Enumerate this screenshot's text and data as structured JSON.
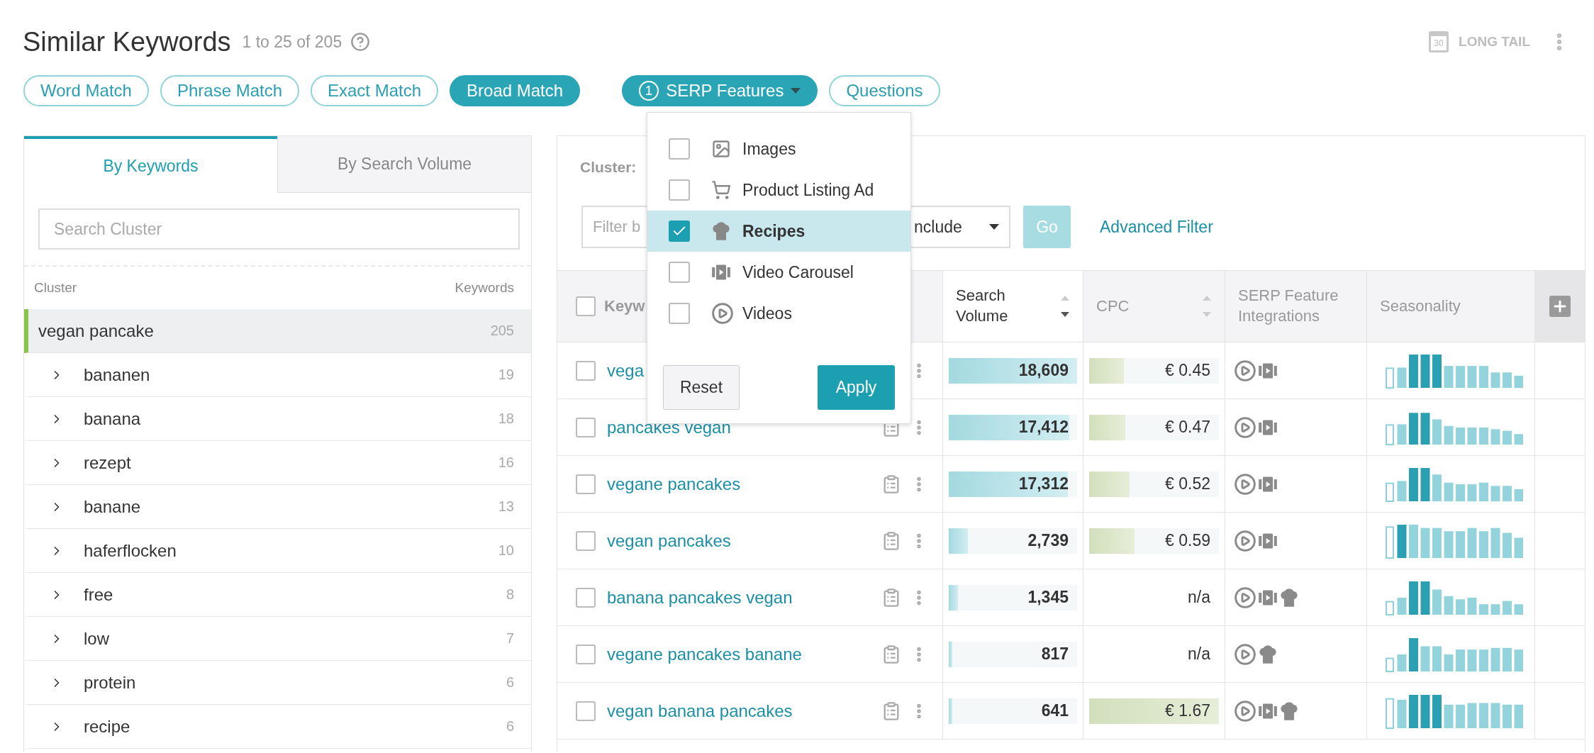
{
  "header": {
    "title": "Similar Keywords",
    "count": "1 to 25 of 205"
  },
  "tools": {
    "calendar_day": "30",
    "label": "LONG TAIL"
  },
  "match_filters": [
    {
      "label": "Word Match",
      "selected": false
    },
    {
      "label": "Phrase Match",
      "selected": false
    },
    {
      "label": "Exact Match",
      "selected": false
    },
    {
      "label": "Broad Match",
      "selected": true
    }
  ],
  "serp_button": {
    "badge": "1",
    "label": "SERP Features",
    "expanded": true
  },
  "questions_button": {
    "label": "Questions"
  },
  "serp_menu": {
    "items": [
      {
        "kind": "images",
        "label": "Images",
        "checked": false
      },
      {
        "kind": "shopping",
        "label": "Product Listing Ad",
        "checked": false
      },
      {
        "kind": "recipe",
        "label": "Recipes",
        "checked": true
      },
      {
        "kind": "carousel",
        "label": "Video Carousel",
        "checked": false
      },
      {
        "kind": "video",
        "label": "Videos",
        "checked": false
      }
    ],
    "reset": "Reset",
    "apply": "Apply"
  },
  "cluster_panel": {
    "tabs": [
      {
        "label": "By Keywords",
        "selected": true
      },
      {
        "label": "By Search Volume",
        "selected": false
      }
    ],
    "search": {
      "placeholder": "Search Cluster"
    },
    "columns": [
      "Cluster",
      "Keywords"
    ],
    "clusters": [
      {
        "name": "vegan pancake",
        "count": "205",
        "selected": true,
        "children": [
          {
            "name": "bananen",
            "count": "19",
            "selected": false,
            "expanded": false
          },
          {
            "name": "banana",
            "count": "18",
            "selected": false,
            "expanded": false
          },
          {
            "name": "rezept",
            "count": "16",
            "selected": false,
            "expanded": false
          },
          {
            "name": "banane",
            "count": "13",
            "selected": false,
            "expanded": false
          },
          {
            "name": "haferflocken",
            "count": "10",
            "selected": false,
            "expanded": false
          },
          {
            "name": "free",
            "count": "8",
            "selected": false,
            "expanded": false
          },
          {
            "name": "low",
            "count": "7",
            "selected": false,
            "expanded": false
          },
          {
            "name": "protein",
            "count": "6",
            "selected": false,
            "expanded": false
          },
          {
            "name": "recipe",
            "count": "6",
            "selected": false,
            "expanded": false
          }
        ]
      }
    ]
  },
  "results": {
    "cluster_label": "Cluster:",
    "filter": {
      "placeholder": "Filter b"
    },
    "mode_select": {
      "value": "nclude"
    },
    "go": "Go",
    "advanced_filter": "Advanced Filter",
    "header_checked": false,
    "columns": [
      {
        "label": "Keyw"
      },
      {
        "label": "Search Volume",
        "sorted": true
      },
      {
        "label": "CPC",
        "sorted": false
      },
      {
        "label": "SERP Feature Integrations"
      },
      {
        "label": "Seasonality"
      }
    ],
    "rows": [
      {
        "keyword": "vega",
        "checked": false,
        "volume": {
          "text": "18,609",
          "level": 1.0
        },
        "cpc": {
          "text": "€ 0.45",
          "level": 0.27
        },
        "features": [
          {
            "kind": "video"
          },
          {
            "kind": "carousel"
          }
        ]
      },
      {
        "keyword": "pancakes vegan",
        "checked": false,
        "volume": {
          "text": "17,412",
          "level": 0.94
        },
        "cpc": {
          "text": "€ 0.47",
          "level": 0.28
        },
        "features": [
          {
            "kind": "video"
          },
          {
            "kind": "carousel"
          }
        ]
      },
      {
        "keyword": "vegane pancakes",
        "checked": false,
        "volume": {
          "text": "17,312",
          "level": 0.93
        },
        "cpc": {
          "text": "€ 0.52",
          "level": 0.31
        },
        "features": [
          {
            "kind": "video"
          },
          {
            "kind": "carousel"
          }
        ]
      },
      {
        "keyword": "vegan pancakes",
        "checked": false,
        "volume": {
          "text": "2,739",
          "level": 0.15
        },
        "cpc": {
          "text": "€ 0.59",
          "level": 0.35
        },
        "features": [
          {
            "kind": "video"
          },
          {
            "kind": "carousel"
          }
        ]
      },
      {
        "keyword": "banana pancakes vegan",
        "checked": false,
        "volume": {
          "text": "1,345",
          "level": 0.07
        },
        "cpc": {
          "text": "n/a"
        },
        "features": [
          {
            "kind": "video"
          },
          {
            "kind": "carousel"
          },
          {
            "kind": "recipe"
          }
        ]
      },
      {
        "keyword": "vegane pancakes banane",
        "checked": false,
        "volume": {
          "text": "817",
          "level": 0.03
        },
        "cpc": {
          "text": "n/a"
        },
        "features": [
          {
            "kind": "video"
          },
          {
            "kind": "recipe"
          }
        ]
      },
      {
        "keyword": "vegan banana pancakes",
        "checked": false,
        "volume": {
          "text": "641",
          "level": 0.03
        },
        "cpc": {
          "text": "€ 1.67",
          "level": 1.0
        },
        "features": [
          {
            "kind": "video"
          },
          {
            "kind": "carousel"
          },
          {
            "kind": "recipe"
          }
        ]
      }
    ]
  }
}
